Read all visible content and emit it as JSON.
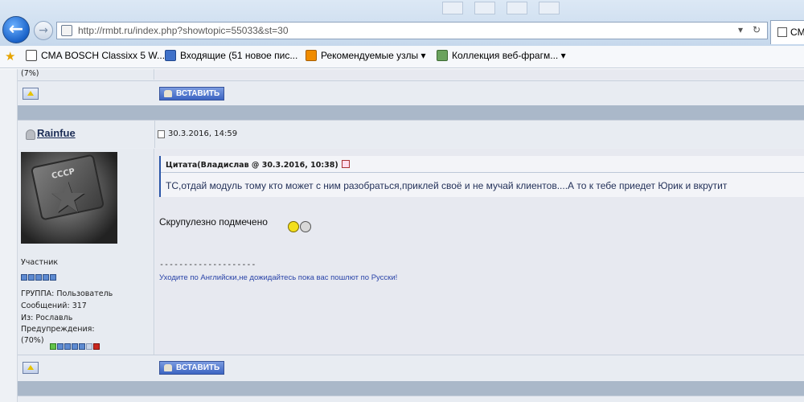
{
  "browser": {
    "url": "http://rmbt.ru/index.php?showtopic=55033&st=30",
    "tab_title": "CMA"
  },
  "favorites": [
    {
      "label": "CMA BOSCH Classixx 5 W...",
      "icon": "page-icon"
    },
    {
      "label": "Входящие (51 новое пис...",
      "icon": "mail-icon"
    },
    {
      "label": "Рекомендуемые узлы ▾",
      "icon": "feed-icon"
    },
    {
      "label": "Коллекция веб-фрагм... ▾",
      "icon": "webslice-icon"
    }
  ],
  "prev_post": {
    "warn_level_fragment": "(7%)",
    "insert_button": "ВСТАВИТЬ"
  },
  "post": {
    "author": "Rainfue",
    "date": "30.3.2016, 14:59",
    "avatar_text": "СССР",
    "rank": "Участник",
    "group": "ГРУППА: Пользователь",
    "messages": "Сообщений: 317",
    "from": "Из: Рославль",
    "warnings_label": "Предупреждения:",
    "warnings_value": "(70%)",
    "quote_header": "Цитата(Владислав @ 30.3.2016, 10:38)",
    "quote_text": "ТС,отдай модуль тому кто может с ним разобраться,приклей своё и не мучай клиентов....А то к тебе приедет Юрик и вкрутит",
    "body": "Скрупулезно подмечено",
    "signature_line": "--------------------",
    "signature": "Уходите по Английски,не дожидайтесь пока вас пошлют по Русски!",
    "insert_button": "ВСТАВИТЬ"
  },
  "colors": {
    "accent": "#3c64c2",
    "link": "#2a44a8"
  }
}
